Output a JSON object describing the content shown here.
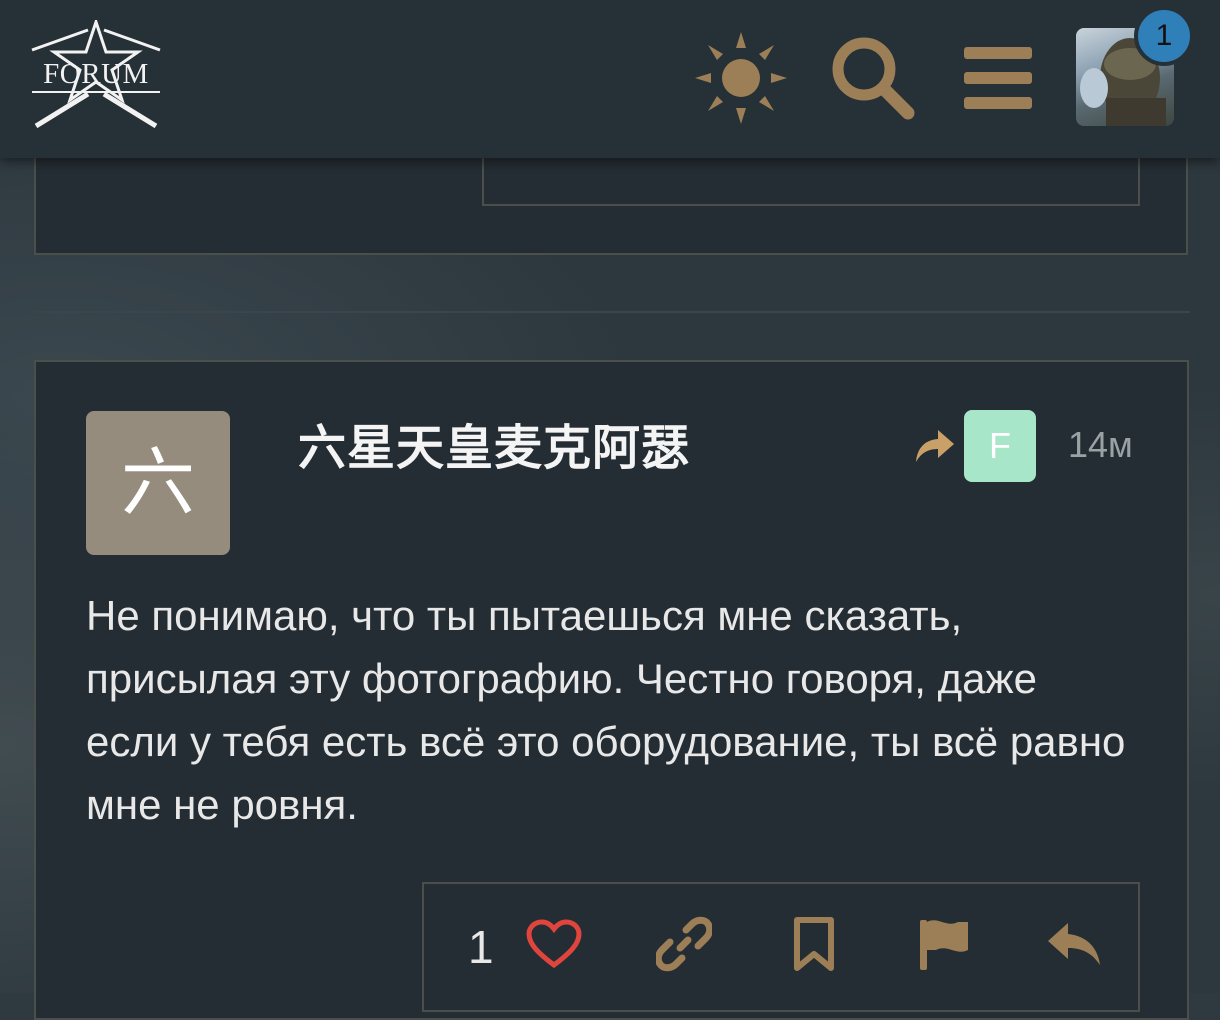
{
  "header": {
    "logo_text": "FORUM",
    "notification_count": "1",
    "icons": [
      "sun-icon",
      "search-icon",
      "menu-icon"
    ]
  },
  "post": {
    "avatar_letter": "六",
    "username": "六星天皇麦克阿瑟",
    "reply_to_avatar_letter": "F",
    "time": "14м",
    "body": "Не понимаю, что ты пытаешься мне сказать, присылая эту фотографию. Честно говоря, даже если у тебя есть всё это оборудование, ты всё равно мне не ровня.",
    "like_count": "1"
  },
  "colors": {
    "accent": "#9c7f56",
    "like": "#e0453d",
    "reply_avatar_bg": "#a7e6c9",
    "user_avatar_bg": "#958c7e",
    "badge": "#2f7fb8"
  }
}
